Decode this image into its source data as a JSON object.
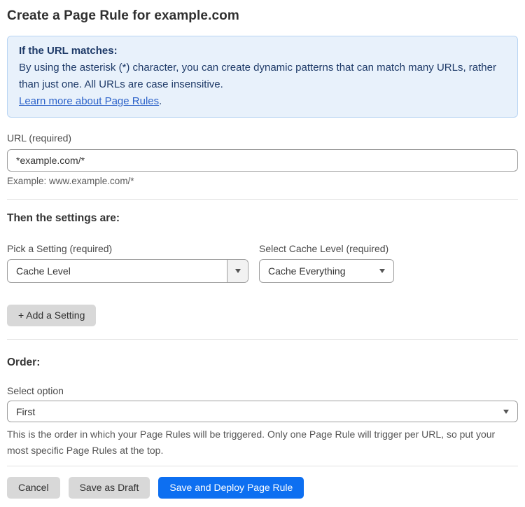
{
  "page": {
    "title": "Create a Page Rule for example.com"
  },
  "info_box": {
    "heading": "If the URL matches:",
    "body": "By using the asterisk (*) character, you can create dynamic patterns that can match many URLs, rather than just one. All URLs are case insensitive.",
    "link": "Learn more about Page Rules",
    "link_suffix": "."
  },
  "url_field": {
    "label": "URL (required)",
    "value": "*example.com/*",
    "helper": "Example: www.example.com/*"
  },
  "settings_section": {
    "heading": "Then the settings are:",
    "setting_picker": {
      "label": "Pick a Setting (required)",
      "value": "Cache Level"
    },
    "cache_level_picker": {
      "label": "Select Cache Level (required)",
      "value": "Cache Everything"
    },
    "add_setting_label": "+ Add a Setting"
  },
  "order_section": {
    "heading": "Order:",
    "label": "Select option",
    "value": "First",
    "helper": "This is the order in which your Page Rules will be triggered. Only one Page Rule will trigger per URL, so put your most specific Page Rules at the top."
  },
  "footer": {
    "cancel_label": "Cancel",
    "save_draft_label": "Save as Draft",
    "deploy_label": "Save and Deploy Page Rule"
  },
  "colors": {
    "info_bg": "#e8f1fb",
    "info_border": "#b9d5f3",
    "info_text": "#1e3a68",
    "link_blue": "#2c62c9",
    "primary_button_blue": "#0d6ff1",
    "secondary_button_gray": "#d8d8d8",
    "input_border": "#9e9e9e",
    "divider_gray": "#e0e0e0"
  }
}
